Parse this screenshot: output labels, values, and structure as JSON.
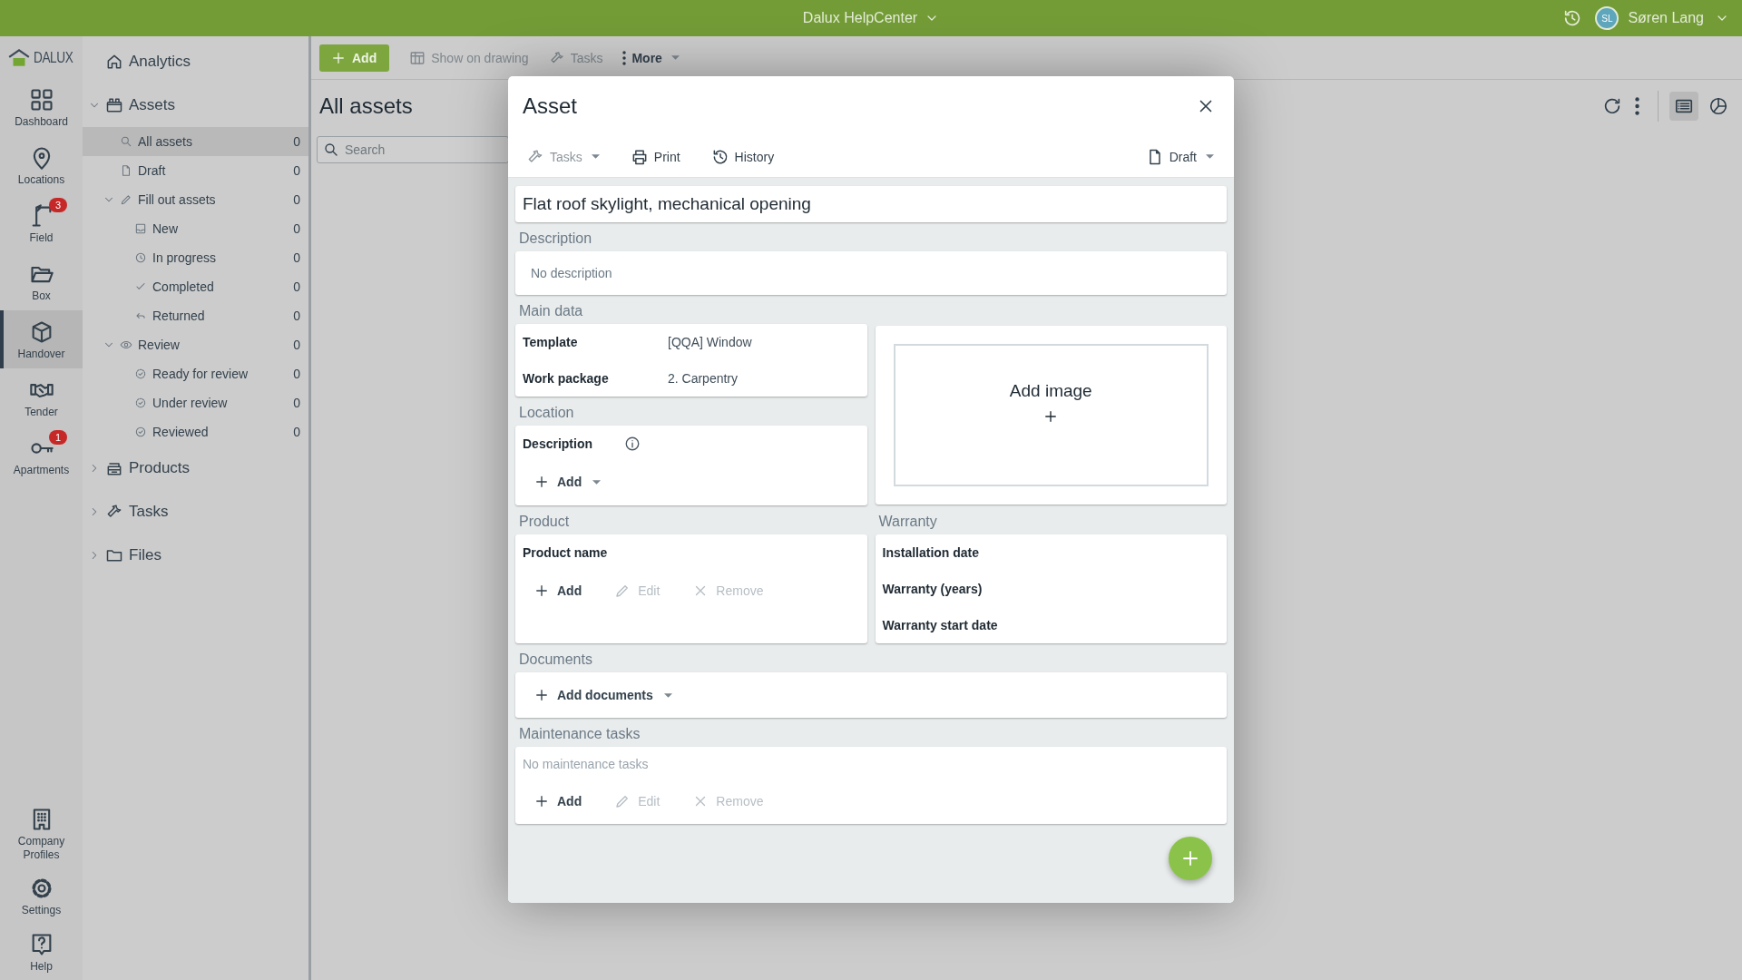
{
  "top_bar": {
    "title": "Dalux HelpCenter",
    "user_initials": "SL",
    "user_name": "Søren Lang"
  },
  "rail": {
    "logo": "DALUX",
    "items": [
      {
        "label": "Dashboard",
        "selected": false
      },
      {
        "label": "Locations",
        "selected": false
      },
      {
        "label": "Field",
        "selected": false,
        "badge": "3"
      },
      {
        "label": "Box",
        "selected": false
      },
      {
        "label": "Handover",
        "selected": true
      },
      {
        "label": "Tender",
        "selected": false
      },
      {
        "label": "Apartments",
        "selected": false,
        "badge": "1"
      }
    ],
    "bottom_items": [
      {
        "label": "Company Profiles"
      },
      {
        "label": "Settings"
      },
      {
        "label": "Help"
      }
    ]
  },
  "sidebar": {
    "items": [
      {
        "label": "Analytics",
        "selected": false
      },
      {
        "label": "Assets",
        "selected": false,
        "expanded": true,
        "children": [
          {
            "label": "All assets",
            "count": "0",
            "selected": true
          },
          {
            "label": "Draft",
            "count": "0",
            "selected": false
          },
          {
            "label": "Fill out assets",
            "count": "0",
            "selected": false,
            "expanded": true,
            "children": [
              {
                "label": "New",
                "count": "0",
                "selected": false
              },
              {
                "label": "In progress",
                "count": "0",
                "selected": false
              },
              {
                "label": "Completed",
                "count": "0",
                "selected": false
              },
              {
                "label": "Returned",
                "count": "0",
                "selected": false
              }
            ]
          },
          {
            "label": "Review",
            "count": "0",
            "selected": false,
            "expanded": true,
            "children": [
              {
                "label": "Ready for review",
                "count": "0",
                "selected": false
              },
              {
                "label": "Under review",
                "count": "0",
                "selected": false
              },
              {
                "label": "Reviewed",
                "count": "0",
                "selected": false
              }
            ]
          }
        ]
      },
      {
        "label": "Products",
        "selected": false,
        "expanded": false
      },
      {
        "label": "Tasks",
        "selected": false,
        "expanded": false
      },
      {
        "label": "Files",
        "selected": false,
        "expanded": false
      }
    ]
  },
  "toolbar": {
    "buttons": [
      {
        "label": "Add",
        "kind": "primary",
        "disabled": false
      },
      {
        "label": "Show on drawing",
        "kind": "plain",
        "disabled": true
      },
      {
        "label": "Tasks",
        "kind": "plain",
        "disabled": true
      },
      {
        "label": "More",
        "kind": "menu",
        "disabled": false
      }
    ]
  },
  "list": {
    "title": "All assets",
    "search_placeholder": "Search",
    "views": [
      {
        "selected": true
      },
      {
        "selected": false
      }
    ]
  },
  "modal": {
    "title": "Asset",
    "actions": [
      {
        "label": "Tasks",
        "disabled": true,
        "dropdown": true
      },
      {
        "label": "Print",
        "disabled": false,
        "dropdown": false
      },
      {
        "label": "History",
        "disabled": false,
        "dropdown": false
      }
    ],
    "status": "Draft",
    "name": "Flat roof skylight, mechanical opening",
    "description": {
      "heading": "Description",
      "text": "No description"
    },
    "main_data": {
      "heading": "Main data",
      "fields": [
        {
          "label": "Template",
          "value": "[QQA] Window"
        },
        {
          "label": "Work package",
          "value": "2. Carpentry"
        }
      ]
    },
    "image": {
      "label": "Add image"
    },
    "location": {
      "heading": "Location",
      "field_label": "Description",
      "add": "Add"
    },
    "product": {
      "heading": "Product",
      "field_label": "Product name",
      "actions": [
        {
          "label": "Add",
          "disabled": false
        },
        {
          "label": "Edit",
          "disabled": true
        },
        {
          "label": "Remove",
          "disabled": true
        }
      ]
    },
    "warranty": {
      "heading": "Warranty",
      "fields": [
        "Installation date",
        "Warranty (years)",
        "Warranty start date"
      ]
    },
    "documents": {
      "heading": "Documents",
      "add": "Add documents"
    },
    "maintenance": {
      "heading": "Maintenance tasks",
      "empty_text": "No maintenance tasks",
      "actions": [
        {
          "label": "Add",
          "disabled": false
        },
        {
          "label": "Edit",
          "disabled": true
        },
        {
          "label": "Remove",
          "disabled": true
        }
      ]
    }
  }
}
